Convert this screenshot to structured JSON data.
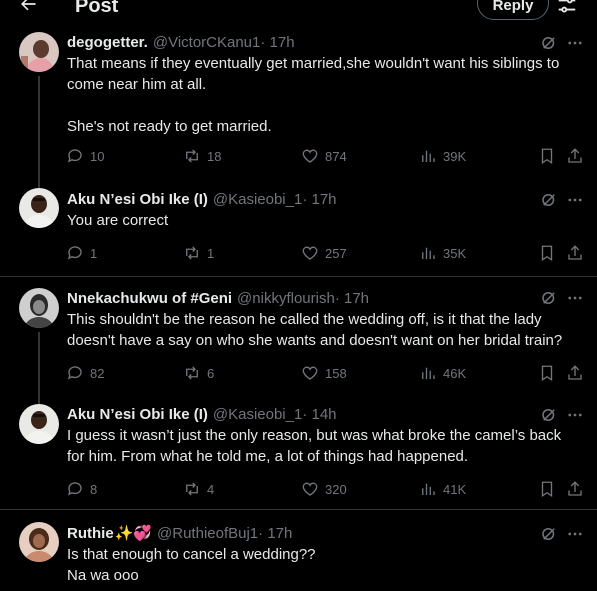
{
  "header": {
    "title": "Post",
    "reply_label": "Reply"
  },
  "colors": {
    "background": "#000000",
    "text": "#e7e9ea",
    "muted": "#71767b",
    "border": "#2f3336"
  },
  "tweets": [
    {
      "name": "degogetter.",
      "handle": "@VictorCKanu1",
      "time": " · 17h",
      "lines": [
        "That means if they eventually get married,she wouldn't want his siblings to",
        "come near him at all.",
        "",
        "She's not ready to get married."
      ],
      "replies": "10",
      "reposts": "18",
      "likes": "874",
      "views": "39K"
    },
    {
      "name": "Aku N’esi Obi Ike (I)",
      "handle": "@Kasieobi_1",
      "time": " · 17h",
      "lines": [
        "You are correct"
      ],
      "replies": "1",
      "reposts": "1",
      "likes": "257",
      "views": "35K"
    },
    {
      "name": "Nnekachukwu of #Geni",
      "handle": "@nikkyflourish",
      "time": " · 17h",
      "lines": [
        "This shouldn't be the reason he called the wedding off, is it that the lady",
        "doesn't have a say on who she wants and doesn't want on her bridal train?"
      ],
      "replies": "82",
      "reposts": "6",
      "likes": "158",
      "views": "46K"
    },
    {
      "name": "Aku N’esi Obi Ike (I)",
      "handle": "@Kasieobi_1",
      "time": " · 14h",
      "lines": [
        "I guess it wasn’t just the only reason, but was what broke the camel’s back",
        "for him. From what he told me, a lot of things had happened."
      ],
      "replies": "8",
      "reposts": "4",
      "likes": "320",
      "views": "41K"
    },
    {
      "name": "Ruthie",
      "name_emoji": "✨💞",
      "handle": "@RuthieofBuj1",
      "time": " · 17h",
      "lines": [
        "Is that enough to cancel a wedding??",
        "Na wa ooo"
      ]
    }
  ]
}
